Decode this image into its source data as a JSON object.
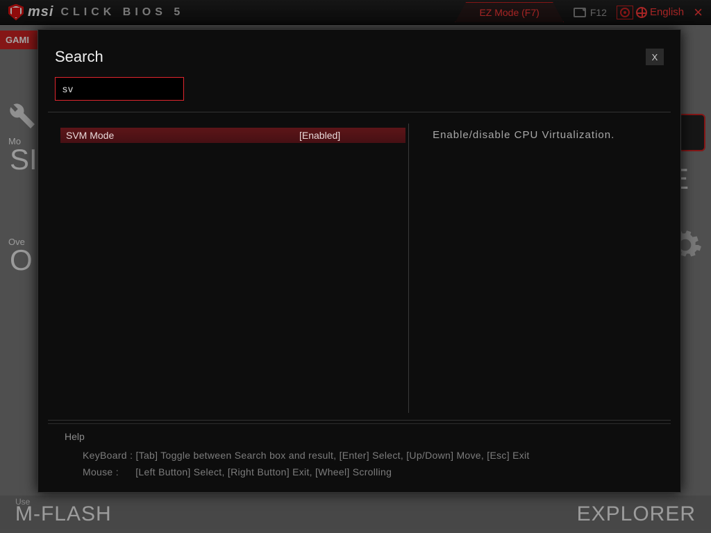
{
  "header": {
    "brand": "msi",
    "product": "CLICK BIOS 5",
    "ez_mode": "EZ Mode (F7)",
    "hotkey": "F12",
    "language": "English"
  },
  "background": {
    "left_tab": "GAMI",
    "left1_small": "Mo",
    "left1_big": "SI",
    "left2_small": "Ove",
    "left2_big": "O",
    "right_big": "E",
    "bottom_use": "Use",
    "bottom_left": "M-FLASH",
    "bottom_right": "EXPLORER"
  },
  "modal": {
    "title": "Search",
    "close": "X",
    "query": "sv",
    "results": [
      {
        "name": "SVM Mode",
        "value": "[Enabled]"
      }
    ],
    "description": "Enable/disable CPU Virtualization.",
    "help_label": "Help",
    "help_keyboard_label": "KeyBoard :",
    "help_keyboard": "[Tab]  Toggle between Search box and result,   [Enter]  Select,   [Up/Down]  Move,   [Esc]  Exit",
    "help_mouse_label": "Mouse    :",
    "help_mouse": "[Left Button]  Select,   [Right Button]  Exit,   [Wheel]  Scrolling"
  }
}
